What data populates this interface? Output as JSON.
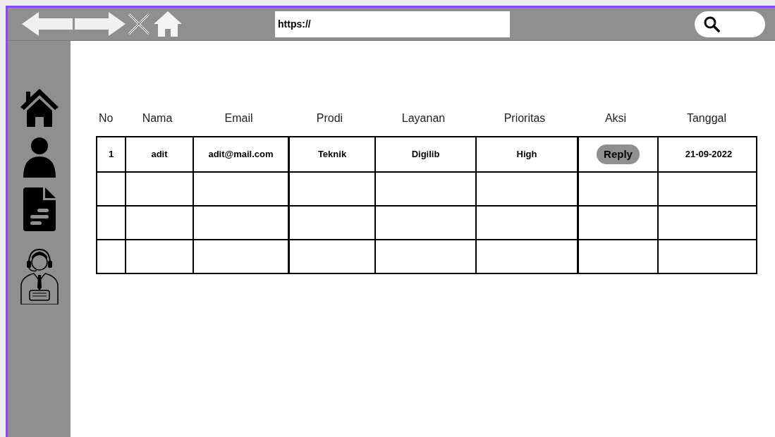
{
  "browser": {
    "url": "https://"
  },
  "table": {
    "columns": [
      "No",
      "Nama",
      "Email",
      "Prodi",
      "Layanan",
      "Prioritas",
      "Aksi",
      "Tanggal"
    ],
    "rows": [
      {
        "no": "1",
        "nama": "adit",
        "email": "adit@mail.com",
        "prodi": "Teknik",
        "layanan": "Digilib",
        "prioritas": "High",
        "action": "Reply",
        "tanggal": "21-09-2022"
      },
      {},
      {},
      {}
    ]
  }
}
